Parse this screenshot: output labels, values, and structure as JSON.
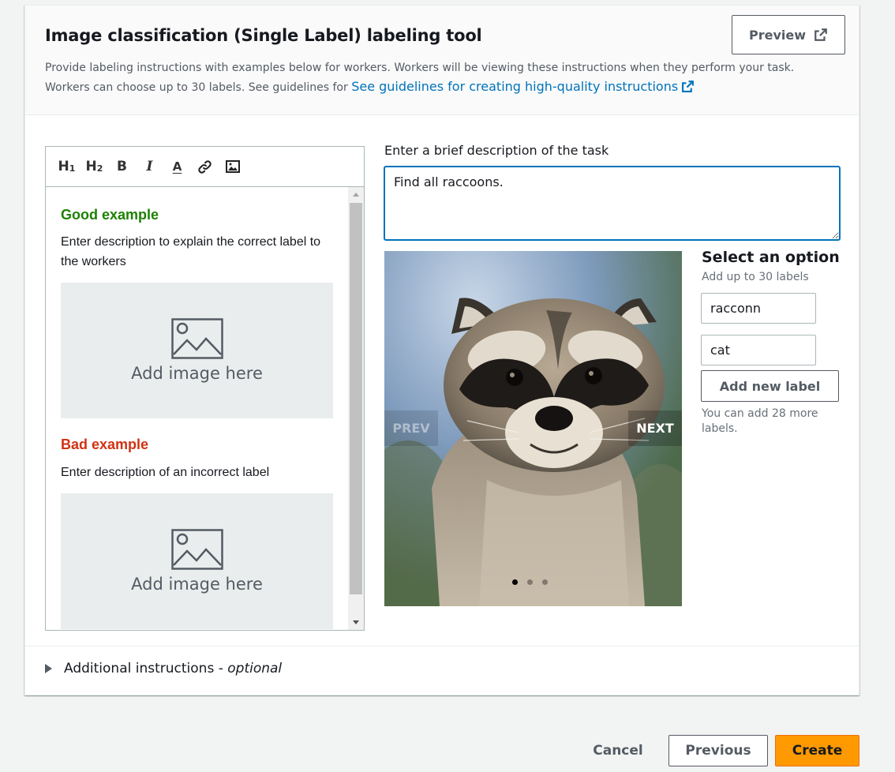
{
  "header": {
    "title": "Image classification (Single Label) labeling tool",
    "description": "Provide labeling instructions with examples below for workers. Workers will be viewing these instructions when they perform your task. Workers can choose up to 30 labels. See guidelines for ",
    "guidelines_link": "See guidelines for creating high-quality instructions",
    "preview_label": "Preview"
  },
  "editor": {
    "toolbar": [
      {
        "name": "heading1-icon",
        "glyph": "H",
        "sub": "1"
      },
      {
        "name": "heading2-icon",
        "glyph": "H",
        "sub": "2"
      },
      {
        "name": "bold-icon",
        "glyph": "B"
      },
      {
        "name": "italic-icon",
        "glyph": "I"
      },
      {
        "name": "text-color-icon",
        "glyph": "A"
      },
      {
        "name": "link-icon",
        "glyph": ""
      },
      {
        "name": "image-icon",
        "glyph": ""
      }
    ],
    "good_heading": "Good example",
    "good_text": "Enter description to explain the correct label to the workers",
    "bad_heading": "Bad example",
    "bad_text": "Enter description of an incorrect label",
    "image_placeholder": "Add image here"
  },
  "task": {
    "label": "Enter a brief description of the task",
    "value": "Find all raccoons."
  },
  "carousel": {
    "prev_label": "PREV",
    "next_label": "NEXT",
    "dot_count": 3,
    "active_dot": 0
  },
  "options": {
    "title": "Select an option",
    "subtitle": "Add up to 30 labels",
    "labels": [
      "racconn",
      "cat"
    ],
    "add_label_button": "Add new label",
    "remaining_text": "You can add 28 more labels."
  },
  "additional": {
    "label": "Additional instructions - ",
    "optional": "optional"
  },
  "footer": {
    "cancel": "Cancel",
    "previous": "Previous",
    "create": "Create"
  },
  "colors": {
    "accent": "#0073bb",
    "good": "#1d8102",
    "bad": "#d13212",
    "primary_button": "#ff9900"
  }
}
